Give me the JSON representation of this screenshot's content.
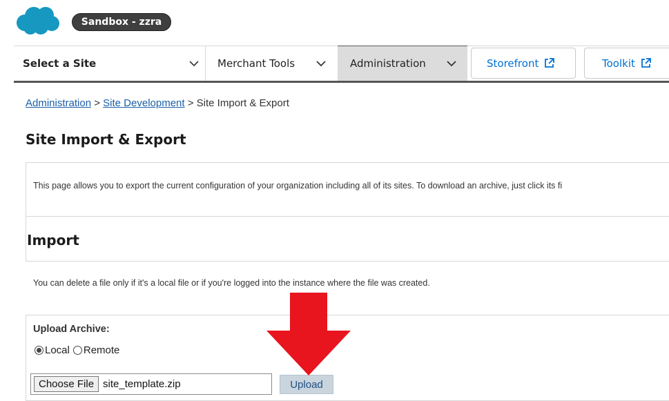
{
  "header": {
    "sandbox_label": "Sandbox - zzra"
  },
  "nav": {
    "select_site": "Select a Site",
    "merchant_tools": "Merchant Tools",
    "administration": "Administration",
    "storefront": "Storefront",
    "toolkit": "Toolkit"
  },
  "breadcrumb": {
    "item1": "Administration",
    "sep1": ">",
    "item2": "Site Development",
    "sep2": ">",
    "current": "Site Import & Export"
  },
  "page": {
    "title": "Site Import & Export",
    "intro": "This page allows you to export the current configuration of your organization including all of its sites. To download an archive, just click its fi",
    "import_title": "Import",
    "delete_note": "You can delete a file only if it's a local file or if you're logged into the instance where the file was created."
  },
  "upload": {
    "label": "Upload Archive:",
    "option_local": "Local",
    "option_remote": "Remote",
    "selected": "Local",
    "choose_label": "Choose File",
    "file_name": "site_template.zip",
    "upload_label": "Upload"
  },
  "colors": {
    "link": "#1a5fa8",
    "accent_blue": "#0070d2",
    "arrow": "#e8141e",
    "sandbox_pill": "#3f3f3f"
  },
  "icons": {
    "logo": "salesforce-cloud-icon",
    "chevron": "chevron-down-icon",
    "external": "external-link-icon",
    "arrow": "red-down-arrow-icon"
  }
}
